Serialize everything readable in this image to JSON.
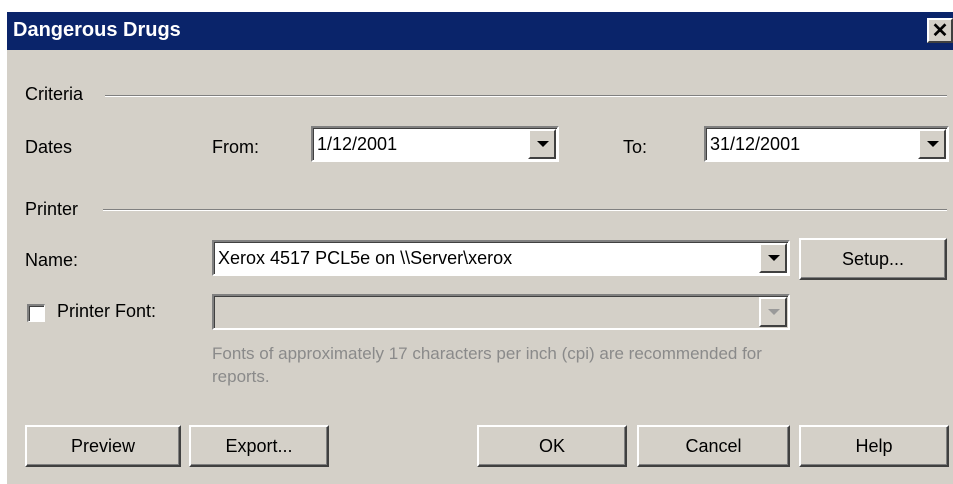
{
  "window": {
    "title": "Dangerous Drugs",
    "close_glyph": "✕"
  },
  "criteria": {
    "group_label": "Criteria",
    "dates_label": "Dates",
    "from_label": "From:",
    "from_value": "1/12/2001",
    "to_label": "To:",
    "to_value": "31/12/2001"
  },
  "printer": {
    "group_label": "Printer",
    "name_label": "Name:",
    "name_value": "Xerox 4517 PCL5e on \\\\Server\\xerox",
    "setup_label": "Setup...",
    "font_checkbox_label": "Printer Font:",
    "font_checkbox_checked": false,
    "font_value": "",
    "hint_text": "Fonts of approximately 17 characters per inch (cpi) are recommended for reports."
  },
  "buttons": {
    "preview": "Preview",
    "export": "Export...",
    "ok": "OK",
    "cancel": "Cancel",
    "help": "Help"
  },
  "colors": {
    "title_bar": "#0a246a",
    "dialog_face": "#d4d0c8",
    "disabled_text": "#8a8a8a"
  }
}
